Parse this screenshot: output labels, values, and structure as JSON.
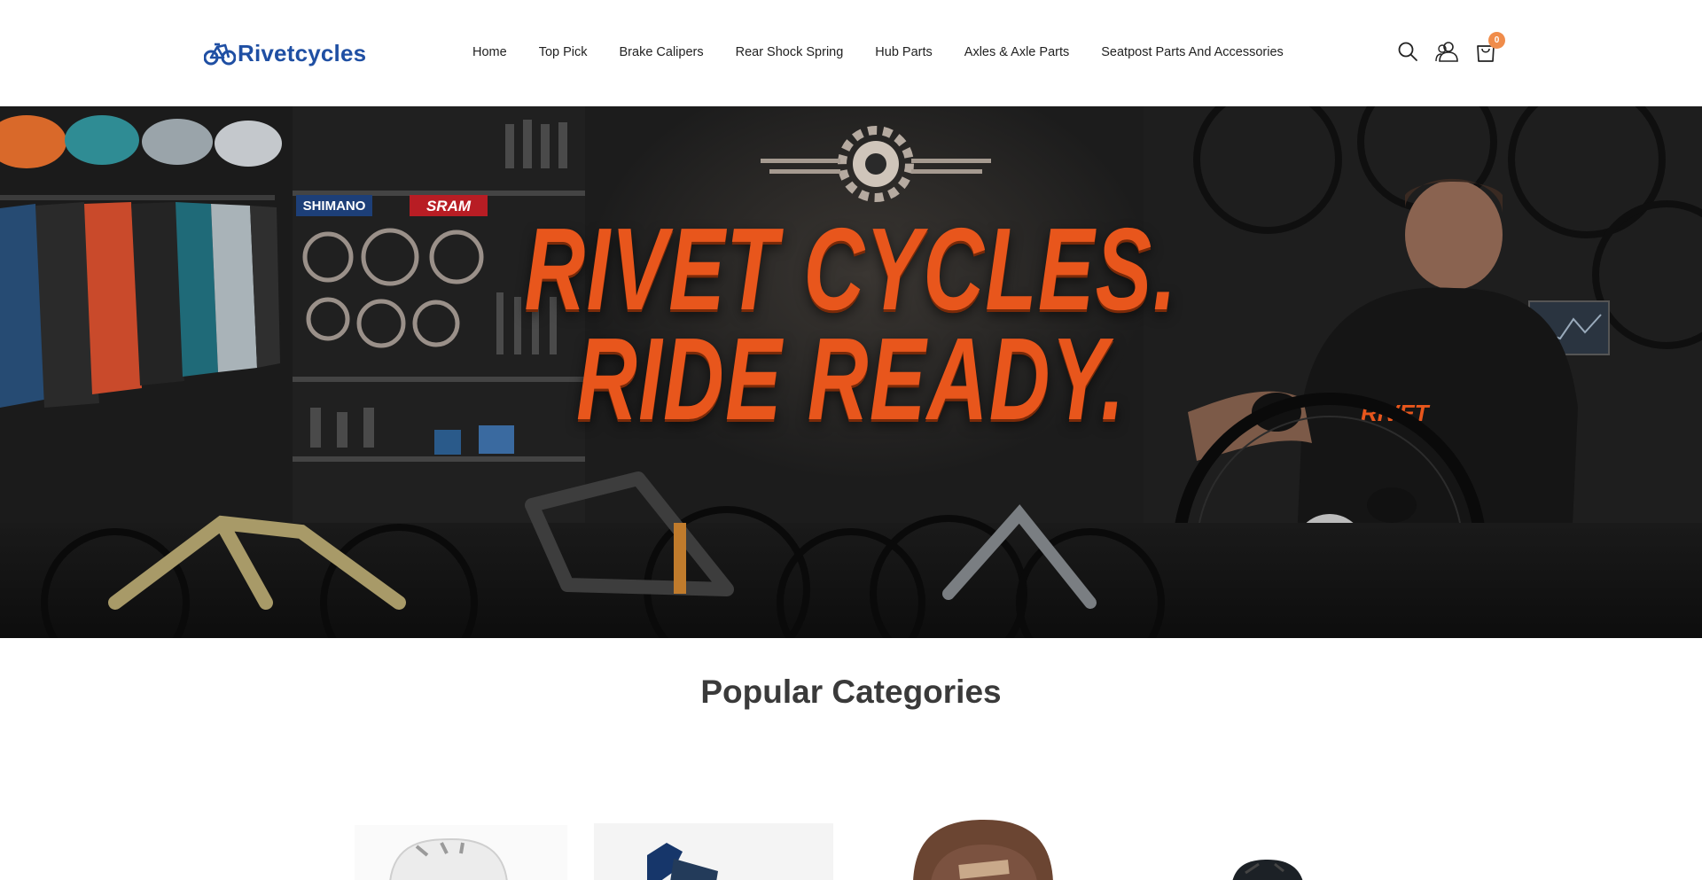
{
  "header": {
    "logo_text": "Rivetcycles",
    "nav": [
      {
        "label": "Home"
      },
      {
        "label": "Top Pick"
      },
      {
        "label": "Brake Calipers"
      },
      {
        "label": "Rear Shock Spring"
      },
      {
        "label": "Hub Parts"
      },
      {
        "label": "Axles & Axle Parts"
      },
      {
        "label": "Seatpost Parts And Accessories"
      }
    ],
    "icons": [
      "search-icon",
      "account-icon",
      "cart-icon"
    ],
    "cart_count": "0"
  },
  "hero": {
    "line1": "RIVET CYCLES.",
    "line2": "RIDE READY.",
    "shelf_brands": [
      "SHIMANO",
      "SRAM"
    ]
  },
  "categories": {
    "title": "Popular Categories",
    "items": [
      {
        "image": "white-helmet"
      },
      {
        "image": "blue-lock"
      },
      {
        "image": "brown-helmet"
      },
      {
        "image": "black-helmet"
      }
    ]
  },
  "colors": {
    "brand_blue": "#1f4fa3",
    "hero_orange": "#e8561c",
    "badge_orange": "#f08c4a"
  }
}
